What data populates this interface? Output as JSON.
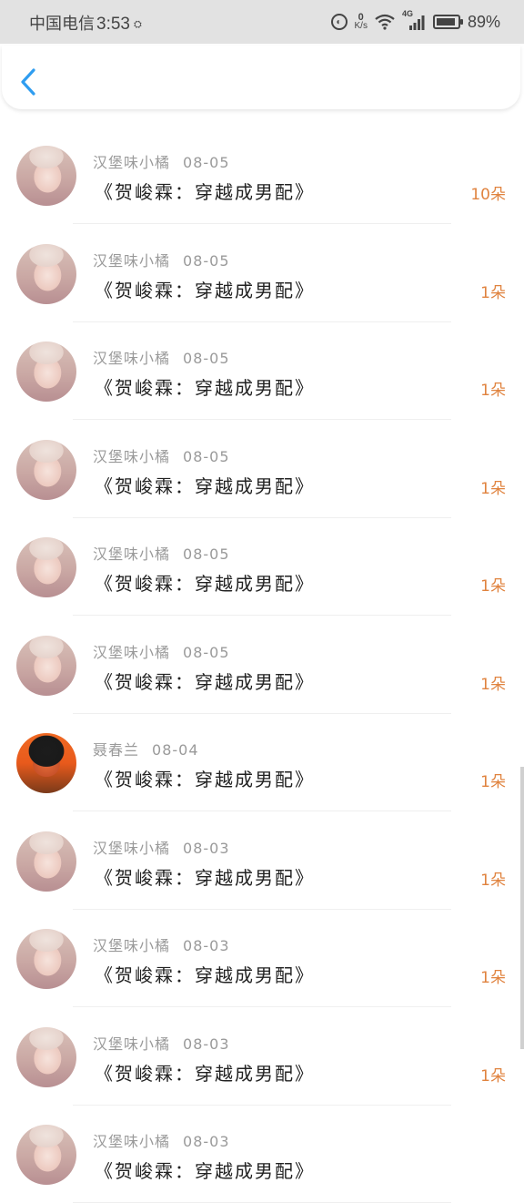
{
  "status_bar": {
    "carrier": "中国电信",
    "time": "3:53",
    "net_speed_value": "0",
    "net_speed_unit": "K/s",
    "signal_type": "4G",
    "battery_percent": "89%",
    "battery_level": 0.89
  },
  "header": {
    "back_icon": "chevron-left-icon",
    "accent_color": "#2f9df0"
  },
  "list": {
    "amount_color": "#e0833f",
    "items": [
      {
        "avatar": "girl",
        "name": "汉堡味小橘",
        "date": "08-05",
        "title": "《贺峻霖：穿越成男配》",
        "amount": "10朵"
      },
      {
        "avatar": "girl",
        "name": "汉堡味小橘",
        "date": "08-05",
        "title": "《贺峻霖：穿越成男配》",
        "amount": "1朵"
      },
      {
        "avatar": "girl",
        "name": "汉堡味小橘",
        "date": "08-05",
        "title": "《贺峻霖：穿越成男配》",
        "amount": "1朵"
      },
      {
        "avatar": "girl",
        "name": "汉堡味小橘",
        "date": "08-05",
        "title": "《贺峻霖：穿越成男配》",
        "amount": "1朵"
      },
      {
        "avatar": "girl",
        "name": "汉堡味小橘",
        "date": "08-05",
        "title": "《贺峻霖：穿越成男配》",
        "amount": "1朵"
      },
      {
        "avatar": "girl",
        "name": "汉堡味小橘",
        "date": "08-05",
        "title": "《贺峻霖：穿越成男配》",
        "amount": "1朵"
      },
      {
        "avatar": "boy",
        "name": "聂春兰",
        "date": "08-04",
        "title": "《贺峻霖：穿越成男配》",
        "amount": "1朵"
      },
      {
        "avatar": "girl",
        "name": "汉堡味小橘",
        "date": "08-03",
        "title": "《贺峻霖：穿越成男配》",
        "amount": "1朵"
      },
      {
        "avatar": "girl",
        "name": "汉堡味小橘",
        "date": "08-03",
        "title": "《贺峻霖：穿越成男配》",
        "amount": "1朵"
      },
      {
        "avatar": "girl",
        "name": "汉堡味小橘",
        "date": "08-03",
        "title": "《贺峻霖：穿越成男配》",
        "amount": "1朵"
      },
      {
        "avatar": "girl",
        "name": "汉堡味小橘",
        "date": "08-03",
        "title": "《贺峻霖：穿越成男配》",
        "amount": ""
      }
    ]
  }
}
